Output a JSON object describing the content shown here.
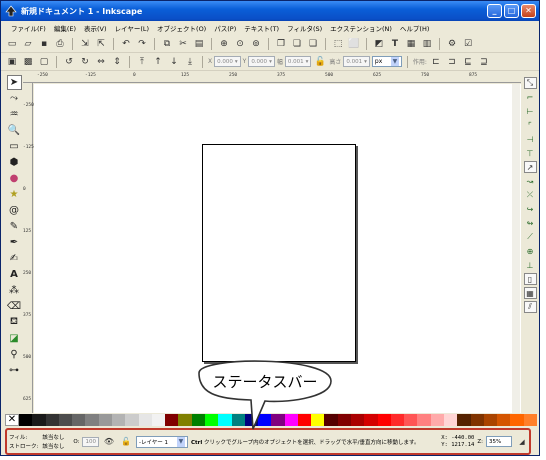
{
  "window": {
    "title": "新規ドキュメント 1 - Inkscape",
    "buttons": {
      "minimize": "_",
      "maximize": "□",
      "close": "✕"
    }
  },
  "menu": [
    "ファイル(F)",
    "編集(E)",
    "表示(V)",
    "レイヤー(L)",
    "オブジェクト(O)",
    "パス(P)",
    "テキスト(T)",
    "フィルタ(S)",
    "エクステンション(N)",
    "ヘルプ(H)"
  ],
  "controls": {
    "x_label": "X",
    "x_value": "0.000",
    "y_label": "Y",
    "y_value": "0.000",
    "w_label": "幅",
    "w_value": "0.001",
    "h_label": "高さ",
    "h_value": "0.001",
    "unit": "px",
    "affect_label": "作用:"
  },
  "rulers": {
    "top": [
      "-250",
      "-125",
      "0",
      "125",
      "250",
      "375",
      "500",
      "625",
      "750",
      "875"
    ],
    "left": [
      "-250",
      "-125",
      "0",
      "125",
      "250",
      "375",
      "500",
      "625"
    ]
  },
  "palette_colors": [
    "#000000",
    "#1a1a1a",
    "#333333",
    "#4d4d4d",
    "#666666",
    "#808080",
    "#999999",
    "#b3b3b3",
    "#cccccc",
    "#e6e6e6",
    "#f2f2f2",
    "#800000",
    "#808000",
    "#008000",
    "#00ff00",
    "#00ffff",
    "#008080",
    "#000080",
    "#0000ff",
    "#800080",
    "#ff00ff",
    "#ff0000",
    "#ffff00",
    "#550000",
    "#800000",
    "#aa0000",
    "#d40000",
    "#ff0000",
    "#ff2a2a",
    "#ff5555",
    "#ff8080",
    "#ffaaaa",
    "#ffd5d5",
    "#552200",
    "#803300",
    "#aa4400",
    "#d45500",
    "#ff6600",
    "#ff7f2a"
  ],
  "status": {
    "fill_label": "フィル:",
    "fill_value": "該当なし",
    "stroke_label": "ストローク:",
    "stroke_value": "該当なし",
    "opacity_label": "O:",
    "opacity_value": "100",
    "layer": "-レイヤー 1",
    "message_key": "Ctrl",
    "message": "クリックでグループ内のオブジェクトを選択、ドラッグで水平/垂直方向に移動します。",
    "x_label": "X:",
    "x_value": "-440.00",
    "y_label": "Y:",
    "y_value": "1217.14",
    "zoom_label": "Z:",
    "zoom_value": "35%"
  },
  "callout": {
    "text": "ステータスバー"
  }
}
